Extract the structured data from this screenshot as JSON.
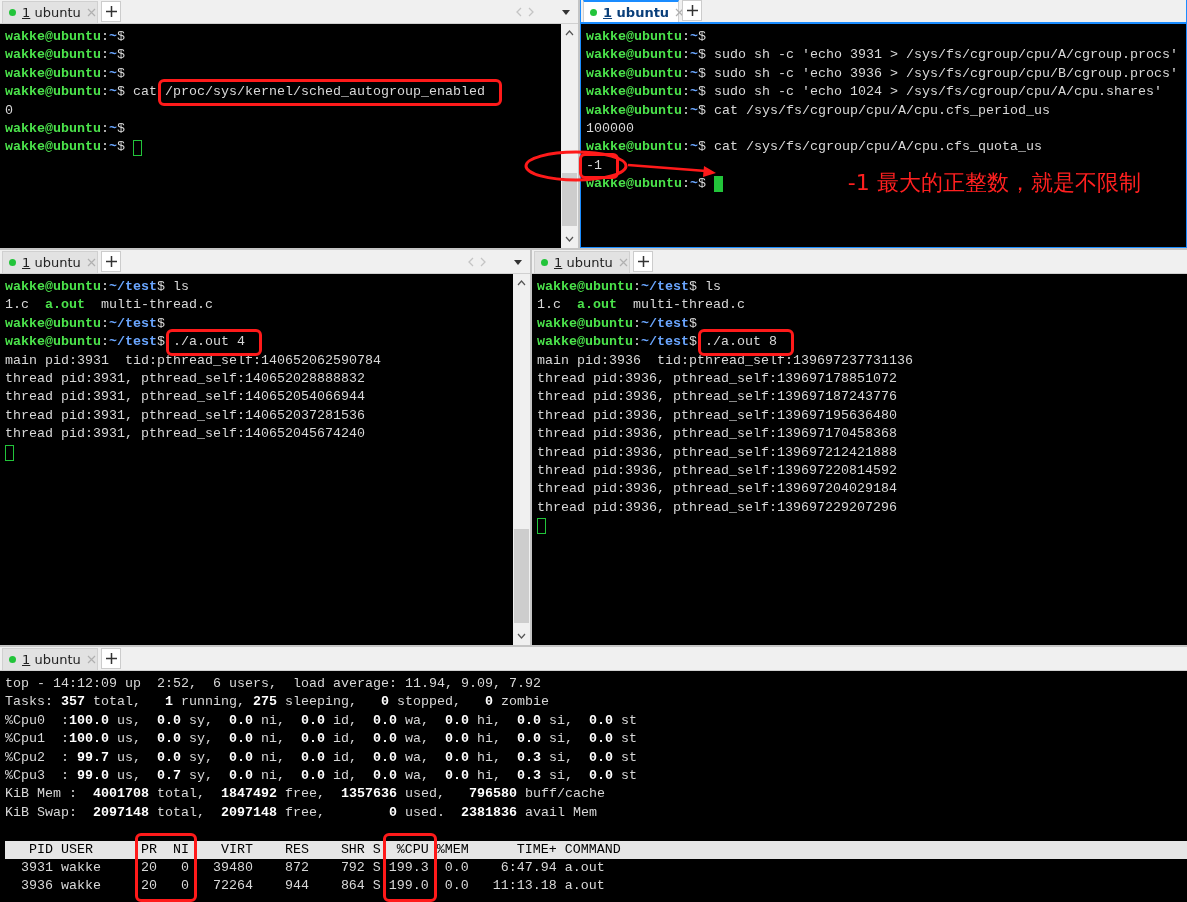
{
  "rows": [
    {
      "panes": [
        {
          "tab": {
            "number": "1",
            "title": "ubuntu",
            "selected": false
          },
          "tab_scroll": true,
          "scrollbar": true,
          "lines": [
            {
              "segments": [
                {
                  "text": "wakke@ubuntu",
                  "kind": "user"
                },
                {
                  "text": ":",
                  "kind": "text"
                },
                {
                  "text": "~",
                  "kind": "path"
                },
                {
                  "text": "$",
                  "kind": "text"
                }
              ]
            },
            {
              "segments": [
                {
                  "text": "wakke@ubuntu",
                  "kind": "user"
                },
                {
                  "text": ":",
                  "kind": "text"
                },
                {
                  "text": "~",
                  "kind": "path"
                },
                {
                  "text": "$",
                  "kind": "text"
                }
              ]
            },
            {
              "segments": [
                {
                  "text": "wakke@ubuntu",
                  "kind": "user"
                },
                {
                  "text": ":",
                  "kind": "text"
                },
                {
                  "text": "~",
                  "kind": "path"
                },
                {
                  "text": "$",
                  "kind": "text"
                }
              ]
            },
            {
              "segments": [
                {
                  "text": "wakke@ubuntu",
                  "kind": "user"
                },
                {
                  "text": ":",
                  "kind": "text"
                },
                {
                  "text": "~",
                  "kind": "path"
                },
                {
                  "text": "$ cat ",
                  "kind": "text"
                },
                {
                  "text": "/proc/sys/kernel/sched_autogroup_enabled",
                  "kind": "text",
                  "boxed": true
                }
              ]
            },
            {
              "segments": [
                {
                  "text": "0",
                  "kind": "text"
                }
              ]
            },
            {
              "segments": [
                {
                  "text": "wakke@ubuntu",
                  "kind": "user"
                },
                {
                  "text": ":",
                  "kind": "text"
                },
                {
                  "text": "~",
                  "kind": "path"
                },
                {
                  "text": "$",
                  "kind": "text"
                }
              ]
            },
            {
              "segments": [
                {
                  "text": "wakke@ubuntu",
                  "kind": "user"
                },
                {
                  "text": ":",
                  "kind": "text"
                },
                {
                  "text": "~",
                  "kind": "path"
                },
                {
                  "text": "$ ",
                  "kind": "text"
                }
              ],
              "cursor": true
            }
          ]
        },
        {
          "tab": {
            "number": "1",
            "title": "ubuntu",
            "selected": true
          },
          "tab_scroll": false,
          "scrollbar": false,
          "note": "-1 最大的正整数，就是不限制",
          "lines": [
            {
              "segments": [
                {
                  "text": "wakke@ubuntu",
                  "kind": "user"
                },
                {
                  "text": ":",
                  "kind": "text"
                },
                {
                  "text": "~",
                  "kind": "path"
                },
                {
                  "text": "$",
                  "kind": "text"
                }
              ]
            },
            {
              "segments": [
                {
                  "text": "wakke@ubuntu",
                  "kind": "user"
                },
                {
                  "text": ":",
                  "kind": "text"
                },
                {
                  "text": "~",
                  "kind": "path"
                },
                {
                  "text": "$ sudo sh -c 'echo 3931 > /sys/fs/cgroup/cpu/A/cgroup.procs'",
                  "kind": "text"
                }
              ]
            },
            {
              "segments": [
                {
                  "text": "wakke@ubuntu",
                  "kind": "user"
                },
                {
                  "text": ":",
                  "kind": "text"
                },
                {
                  "text": "~",
                  "kind": "path"
                },
                {
                  "text": "$ sudo sh -c 'echo 3936 > /sys/fs/cgroup/cpu/B/cgroup.procs'",
                  "kind": "text"
                }
              ]
            },
            {
              "segments": [
                {
                  "text": "wakke@ubuntu",
                  "kind": "user"
                },
                {
                  "text": ":",
                  "kind": "text"
                },
                {
                  "text": "~",
                  "kind": "path"
                },
                {
                  "text": "$ sudo sh -c 'echo 1024 > /sys/fs/cgroup/cpu/A/cpu.shares'",
                  "kind": "text"
                }
              ]
            },
            {
              "segments": [
                {
                  "text": "wakke@ubuntu",
                  "kind": "user"
                },
                {
                  "text": ":",
                  "kind": "text"
                },
                {
                  "text": "~",
                  "kind": "path"
                },
                {
                  "text": "$ cat /sys/fs/cgroup/cpu/A/cpu.cfs_period_us",
                  "kind": "text"
                }
              ]
            },
            {
              "segments": [
                {
                  "text": "100000",
                  "kind": "text"
                }
              ]
            },
            {
              "segments": [
                {
                  "text": "wakke@ubuntu",
                  "kind": "user"
                },
                {
                  "text": ":",
                  "kind": "text"
                },
                {
                  "text": "~",
                  "kind": "path"
                },
                {
                  "text": "$ cat /sys/fs/cgroup/cpu/A/cpu.cfs_quota_us",
                  "kind": "text"
                }
              ]
            },
            {
              "segments": [
                {
                  "text": "-1",
                  "kind": "text",
                  "boxed": true
                }
              ]
            },
            {
              "segments": [
                {
                  "text": "wakke@ubuntu",
                  "kind": "user"
                },
                {
                  "text": ":",
                  "kind": "text"
                },
                {
                  "text": "~",
                  "kind": "path"
                },
                {
                  "text": "$ ",
                  "kind": "text"
                }
              ],
              "cursor": true
            }
          ]
        }
      ]
    },
    {
      "panes": [
        {
          "tab": {
            "number": "1",
            "title": "ubuntu",
            "selected": false
          },
          "tab_scroll": true,
          "scrollbar": true,
          "lines": [
            {
              "segments": [
                {
                  "text": "wakke@ubuntu",
                  "kind": "user"
                },
                {
                  "text": ":",
                  "kind": "text"
                },
                {
                  "text": "~/test",
                  "kind": "path"
                },
                {
                  "text": "$ ls",
                  "kind": "text"
                }
              ]
            },
            {
              "segments": [
                {
                  "text": "1.c  ",
                  "kind": "text"
                },
                {
                  "text": "a.out",
                  "kind": "exec"
                },
                {
                  "text": "  multi-thread.c",
                  "kind": "text"
                }
              ]
            },
            {
              "segments": [
                {
                  "text": "wakke@ubuntu",
                  "kind": "user"
                },
                {
                  "text": ":",
                  "kind": "text"
                },
                {
                  "text": "~/test",
                  "kind": "path"
                },
                {
                  "text": "$",
                  "kind": "text"
                }
              ]
            },
            {
              "segments": [
                {
                  "text": "wakke@ubuntu",
                  "kind": "user"
                },
                {
                  "text": ":",
                  "kind": "text"
                },
                {
                  "text": "~/test",
                  "kind": "path"
                },
                {
                  "text": "$ ",
                  "kind": "text"
                },
                {
                  "text": "./a.out 4",
                  "kind": "text",
                  "boxed": true
                }
              ]
            },
            {
              "segments": [
                {
                  "text": "main pid:3931  tid:pthread_self:140652062590784",
                  "kind": "text"
                }
              ]
            },
            {
              "segments": [
                {
                  "text": "thread pid:3931, pthread_self:140652028888832",
                  "kind": "text"
                }
              ]
            },
            {
              "segments": [
                {
                  "text": "thread pid:3931, pthread_self:140652054066944",
                  "kind": "text"
                }
              ]
            },
            {
              "segments": [
                {
                  "text": "thread pid:3931, pthread_self:140652037281536",
                  "kind": "text"
                }
              ]
            },
            {
              "segments": [
                {
                  "text": "thread pid:3931, pthread_self:140652045674240",
                  "kind": "text"
                }
              ]
            },
            {
              "cursor": true
            }
          ]
        },
        {
          "tab": {
            "number": "1",
            "title": "ubuntu",
            "selected": false
          },
          "tab_scroll": false,
          "scrollbar": false,
          "lines": [
            {
              "segments": [
                {
                  "text": "wakke@ubuntu",
                  "kind": "user"
                },
                {
                  "text": ":",
                  "kind": "text"
                },
                {
                  "text": "~/test",
                  "kind": "path"
                },
                {
                  "text": "$ ls",
                  "kind": "text"
                }
              ]
            },
            {
              "segments": [
                {
                  "text": "1.c  ",
                  "kind": "text"
                },
                {
                  "text": "a.out",
                  "kind": "exec"
                },
                {
                  "text": "  multi-thread.c",
                  "kind": "text"
                }
              ]
            },
            {
              "segments": [
                {
                  "text": "wakke@ubuntu",
                  "kind": "user"
                },
                {
                  "text": ":",
                  "kind": "text"
                },
                {
                  "text": "~/test",
                  "kind": "path"
                },
                {
                  "text": "$",
                  "kind": "text"
                }
              ]
            },
            {
              "segments": [
                {
                  "text": "wakke@ubuntu",
                  "kind": "user"
                },
                {
                  "text": ":",
                  "kind": "text"
                },
                {
                  "text": "~/test",
                  "kind": "path"
                },
                {
                  "text": "$ ",
                  "kind": "text"
                },
                {
                  "text": "./a.out 8",
                  "kind": "text",
                  "boxed": true
                }
              ]
            },
            {
              "segments": [
                {
                  "text": "main pid:3936  tid:pthread_self:139697237731136",
                  "kind": "text"
                }
              ]
            },
            {
              "segments": [
                {
                  "text": "thread pid:3936, pthread_self:139697178851072",
                  "kind": "text"
                }
              ]
            },
            {
              "segments": [
                {
                  "text": "thread pid:3936, pthread_self:139697187243776",
                  "kind": "text"
                }
              ]
            },
            {
              "segments": [
                {
                  "text": "thread pid:3936, pthread_self:139697195636480",
                  "kind": "text"
                }
              ]
            },
            {
              "segments": [
                {
                  "text": "thread pid:3936, pthread_self:139697170458368",
                  "kind": "text"
                }
              ]
            },
            {
              "segments": [
                {
                  "text": "thread pid:3936, pthread_self:139697212421888",
                  "kind": "text"
                }
              ]
            },
            {
              "segments": [
                {
                  "text": "thread pid:3936, pthread_self:139697220814592",
                  "kind": "text"
                }
              ]
            },
            {
              "segments": [
                {
                  "text": "thread pid:3936, pthread_self:139697204029184",
                  "kind": "text"
                }
              ]
            },
            {
              "segments": [
                {
                  "text": "thread pid:3936, pthread_self:139697229207296",
                  "kind": "text"
                }
              ]
            },
            {
              "cursor": true
            }
          ]
        }
      ]
    },
    {
      "panes": [
        {
          "tab": {
            "number": "1",
            "title": "ubuntu",
            "selected": false
          },
          "tab_scroll": false,
          "scrollbar": false,
          "summary": [
            "top - 14:12:09 up  2:52,  6 users,  load average: 11.94, 9.09, 7.92",
            "Tasks: **357** total,   **1** running, **275** sleeping,   **0** stopped,   **0** zombie",
            "%Cpu0  :**100.0** us,  **0.0** sy,  **0.0** ni,  **0.0** id,  **0.0** wa,  **0.0** hi,  **0.0** si,  **0.0** st",
            "%Cpu1  :**100.0** us,  **0.0** sy,  **0.0** ni,  **0.0** id,  **0.0** wa,  **0.0** hi,  **0.0** si,  **0.0** st",
            "%Cpu2  : **99.7** us,  **0.0** sy,  **0.0** ni,  **0.0** id,  **0.0** wa,  **0.0** hi,  **0.3** si,  **0.0** st",
            "%Cpu3  : **99.0** us,  **0.7** sy,  **0.0** ni,  **0.0** id,  **0.0** wa,  **0.0** hi,  **0.3** si,  **0.0** st",
            "KiB Mem :  **4001708** total,  **1847492** free,  **1357636** used,   **796580** buff/cache",
            "KiB Swap:  **2097148** total,  **2097148** free,        **0** used.  **2381836** avail Mem"
          ],
          "table": {
            "columns": [
              {
                "label": "PID",
                "boxed": false
              },
              {
                "label": "USER",
                "boxed": false
              },
              {
                "label": "PR",
                "boxed": true
              },
              {
                "label": "NI",
                "boxed": true
              },
              {
                "label": "VIRT",
                "boxed": false
              },
              {
                "label": "RES",
                "boxed": false
              },
              {
                "label": "SHR",
                "boxed": false
              },
              {
                "label": "S",
                "boxed": false
              },
              {
                "label": "%CPU",
                "boxed": true
              },
              {
                "label": "%MEM",
                "boxed": false
              },
              {
                "label": "TIME+",
                "boxed": false
              },
              {
                "label": "COMMAND",
                "boxed": false
              }
            ],
            "rows": [
              [
                "3931",
                "wakke",
                "20",
                "0",
                "39480",
                "872",
                "792",
                "S",
                "199.3",
                "0.0",
                "6:47.94",
                "a.out"
              ],
              [
                "3936",
                "wakke",
                "20",
                "0",
                "72264",
                "944",
                "864",
                "S",
                "199.0",
                "0.0",
                "11:13.18",
                "a.out"
              ]
            ]
          }
        }
      ]
    }
  ]
}
